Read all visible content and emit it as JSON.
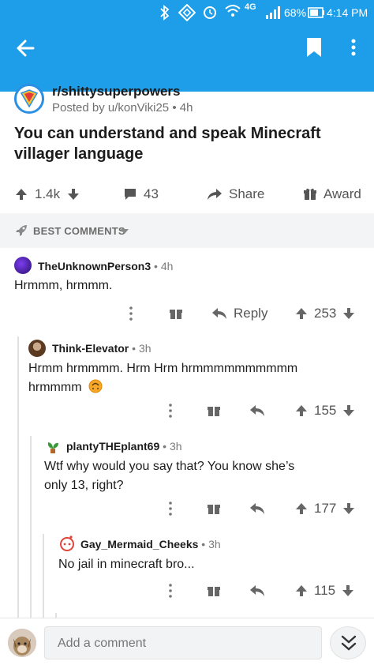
{
  "status_bar": {
    "battery": "68%",
    "time": "4:14 PM",
    "network": "4G"
  },
  "post": {
    "subreddit": "r/shittysuperpowers",
    "posted_by": "Posted by u/konViki25",
    "age": "4h",
    "title": "You can understand and speak Minecraft villager language",
    "votes": "1.4k",
    "comments": "43",
    "share_label": "Share",
    "award_label": "Award"
  },
  "sort": {
    "label": "BEST COMMENTS"
  },
  "comments": [
    {
      "author": "TheUnknownPerson3",
      "age": "4h",
      "body": "Hrmmm, hrmmm.",
      "reply_label": "Reply",
      "score": "253"
    },
    {
      "author": "Think-Elevator",
      "age": "3h",
      "body": "Hrmm hrmmmm. Hrm Hrm hrmmmmmmmmmm hrmmmm",
      "score": "155"
    },
    {
      "author": "plantyTHEplant69",
      "age": "3h",
      "body": "Wtf why would you say that? You know she’s only 13, right?",
      "score": "177"
    },
    {
      "author": "Gay_Mermaid_Cheeks",
      "age": "3h",
      "body": "No jail in minecraft bro...",
      "score": "115"
    }
  ],
  "composer": {
    "placeholder": "Add a comment"
  },
  "colors": {
    "brand": "#1e9ee9",
    "upvote_gray": "#555555"
  },
  "icons": [
    "back-arrow-icon",
    "bookmark-icon",
    "more-vert-icon",
    "upvote-icon",
    "downvote-icon",
    "comment-icon",
    "share-icon",
    "award-icon",
    "rocket-icon",
    "reply-icon",
    "collapse-icon"
  ]
}
